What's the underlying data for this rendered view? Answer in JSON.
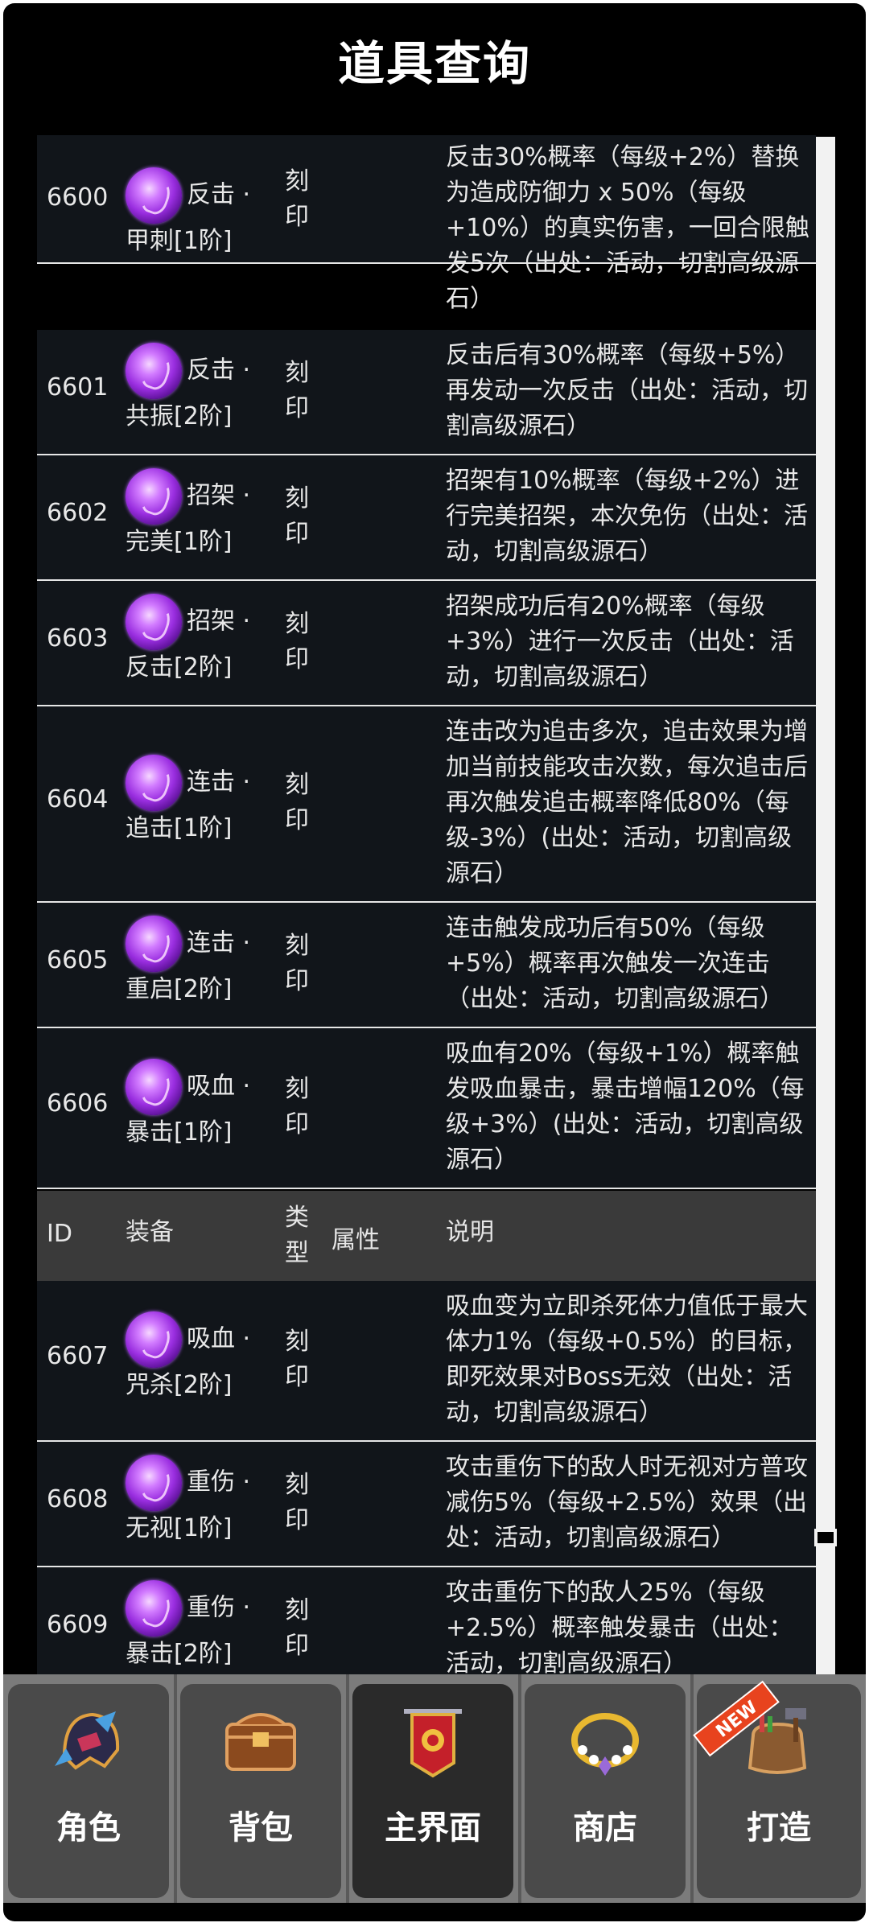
{
  "page": {
    "title": "道具查询"
  },
  "table": {
    "header": {
      "id": "ID",
      "equip": "装备",
      "type": "类\n型",
      "attr": "属性",
      "desc": "说明"
    },
    "rows": [
      {
        "id": "6600",
        "name_line1": "反击 ·",
        "name_line2": "甲刺[1阶]",
        "type": "刻\n印",
        "attr": "",
        "desc": "反击30%概率（每级+2%）替换为造成防御力 x 50%（每级+10%）的真实伤害，一回合限触发5次（出处：活动，切割高级源石）"
      },
      {
        "id": "6601",
        "name_line1": "反击 ·",
        "name_line2": "共振[2阶]",
        "type": "刻\n印",
        "attr": "",
        "desc": "反击后有30%概率（每级+5%）再发动一次反击（出处：活动，切割高级源石）"
      },
      {
        "id": "6602",
        "name_line1": "招架 ·",
        "name_line2": "完美[1阶]",
        "type": "刻\n印",
        "attr": "",
        "desc": "招架有10%概率（每级+2%）进行完美招架，本次免伤（出处：活动，切割高级源石）"
      },
      {
        "id": "6603",
        "name_line1": "招架 ·",
        "name_line2": "反击[2阶]",
        "type": "刻\n印",
        "attr": "",
        "desc": "招架成功后有20%概率（每级+3%）进行一次反击（出处：活动，切割高级源石）"
      },
      {
        "id": "6604",
        "name_line1": "连击 ·",
        "name_line2": "追击[1阶]",
        "type": "刻\n印",
        "attr": "",
        "desc": "连击改为追击多次，追击效果为增加当前技能攻击次数，每次追击后再次触发追击概率降低80%（每级-3%）(出处：活动，切割高级源石）"
      },
      {
        "id": "6605",
        "name_line1": "连击 ·",
        "name_line2": "重启[2阶]",
        "type": "刻\n印",
        "attr": "",
        "desc": "连击触发成功后有50%（每级+5%）概率再次触发一次连击（出处：活动，切割高级源石）"
      },
      {
        "id": "6606",
        "name_line1": "吸血 ·",
        "name_line2": "暴击[1阶]",
        "type": "刻\n印",
        "attr": "",
        "desc": "吸血有20%（每级+1%）概率触发吸血暴击，暴击增幅120%（每级+3%）(出处：活动，切割高级源石）"
      },
      {
        "id": "6607",
        "name_line1": "吸血 ·",
        "name_line2": "咒杀[2阶]",
        "type": "刻\n印",
        "attr": "",
        "desc": "吸血变为立即杀死体力值低于最大体力1%（每级+0.5%）的目标，即死效果对Boss无效（出处：活动，切割高级源石）"
      },
      {
        "id": "6608",
        "name_line1": "重伤 ·",
        "name_line2": "无视[1阶]",
        "type": "刻\n印",
        "attr": "",
        "desc": "攻击重伤下的敌人时无视对方普攻减伤5%（每级+2.5%）效果（出处：活动，切割高级源石）"
      },
      {
        "id": "6609",
        "name_line1": "重伤 ·",
        "name_line2": "暴击[2阶]",
        "type": "刻\n印",
        "attr": "",
        "desc": "攻击重伤下的敌人25%（每级+2.5%）概率触发暴击（出处：活动，切割高级源石）"
      }
    ]
  },
  "nav": {
    "tabs": [
      {
        "label": "角色",
        "icon": "helmet-icon"
      },
      {
        "label": "背包",
        "icon": "treasure-chest-icon"
      },
      {
        "label": "主界面",
        "icon": "banner-icon"
      },
      {
        "label": "商店",
        "icon": "necklace-icon"
      },
      {
        "label": "打造",
        "icon": "crafting-bag-icon",
        "badge": "NEW"
      }
    ],
    "active_index": 2
  }
}
